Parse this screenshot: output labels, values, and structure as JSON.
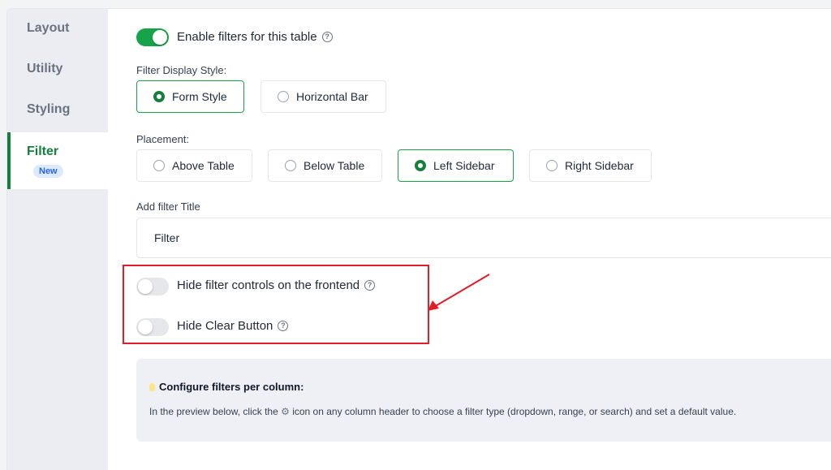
{
  "sidebar": {
    "items": [
      {
        "label": "Layout"
      },
      {
        "label": "Utility"
      },
      {
        "label": "Styling"
      },
      {
        "label": "Filter",
        "badge": "New",
        "active": true
      }
    ]
  },
  "enable_filters": {
    "label": "Enable filters for this table",
    "on": true,
    "help_icon": "question-circle-icon"
  },
  "display_style": {
    "label": "Filter Display Style:",
    "options": [
      "Form Style",
      "Horizontal Bar"
    ],
    "selected": "Form Style"
  },
  "placement": {
    "label": "Placement:",
    "options": [
      "Above Table",
      "Below Table",
      "Left Sidebar",
      "Right Sidebar"
    ],
    "selected": "Left Sidebar"
  },
  "filter_title": {
    "label": "Add filter Title",
    "value": "Filter"
  },
  "hide_controls": {
    "label": "Hide filter controls on the frontend",
    "on": false,
    "help_icon": "question-circle-icon"
  },
  "hide_clear": {
    "label": "Hide Clear Button",
    "on": false,
    "help_icon": "question-circle-icon"
  },
  "info": {
    "icon": "lightbulb-icon",
    "title": "Configure filters per column:",
    "text_before": "In the preview below, click the",
    "gear_icon": "gear-icon",
    "text_after": "icon on any column header to choose a filter type (dropdown, range, or search) and set a default value."
  },
  "colors": {
    "accent": "#15803d",
    "highlight": "#e11d2a",
    "badge": "#2563eb"
  }
}
